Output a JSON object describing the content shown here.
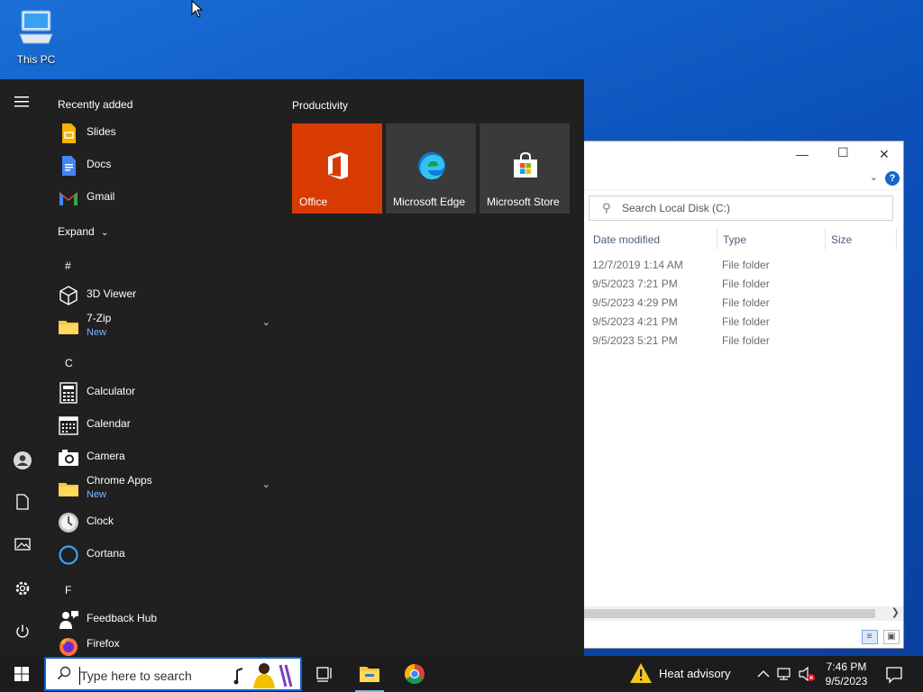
{
  "desktop": {
    "icons": [
      {
        "label": "This PC"
      }
    ]
  },
  "explorer": {
    "search_placeholder": "Search Local Disk (C:)",
    "columns": [
      "Date modified",
      "Type",
      "Size"
    ],
    "rows": [
      {
        "date": "12/7/2019 1:14 AM",
        "type": "File folder"
      },
      {
        "date": "9/5/2023 7:21 PM",
        "type": "File folder"
      },
      {
        "date": "9/5/2023 4:29 PM",
        "type": "File folder"
      },
      {
        "date": "9/5/2023 4:21 PM",
        "type": "File folder"
      },
      {
        "date": "9/5/2023 5:21 PM",
        "type": "File folder"
      }
    ]
  },
  "start": {
    "recently_added_label": "Recently added",
    "recent": [
      {
        "name": "Slides"
      },
      {
        "name": "Docs"
      },
      {
        "name": "Gmail"
      }
    ],
    "expand_label": "Expand",
    "letters": [
      "#",
      "C",
      "F"
    ],
    "apps": [
      {
        "name": "3D Viewer"
      },
      {
        "name": "7-Zip",
        "badge": "New"
      },
      {
        "name": "Calculator"
      },
      {
        "name": "Calendar"
      },
      {
        "name": "Camera"
      },
      {
        "name": "Chrome Apps",
        "badge": "New"
      },
      {
        "name": "Clock"
      },
      {
        "name": "Cortana"
      },
      {
        "name": "Feedback Hub"
      },
      {
        "name": "Firefox"
      }
    ],
    "group_title": "Productivity",
    "tiles": [
      {
        "label": "Office",
        "color": "#d83b01"
      },
      {
        "label": "Microsoft Edge",
        "color": "#3a3a3a"
      },
      {
        "label": "Microsoft Store",
        "color": "#3a3a3a"
      }
    ]
  },
  "taskbar": {
    "search_placeholder": "Type here to search",
    "weather_text": "Heat advisory",
    "time": "7:46 PM",
    "date": "9/5/2023"
  },
  "colors": {
    "accent": "#0a64d6",
    "start_bg": "#202020",
    "taskbar_bg": "#1c1c1c",
    "new_badge": "#7ab8ff"
  }
}
